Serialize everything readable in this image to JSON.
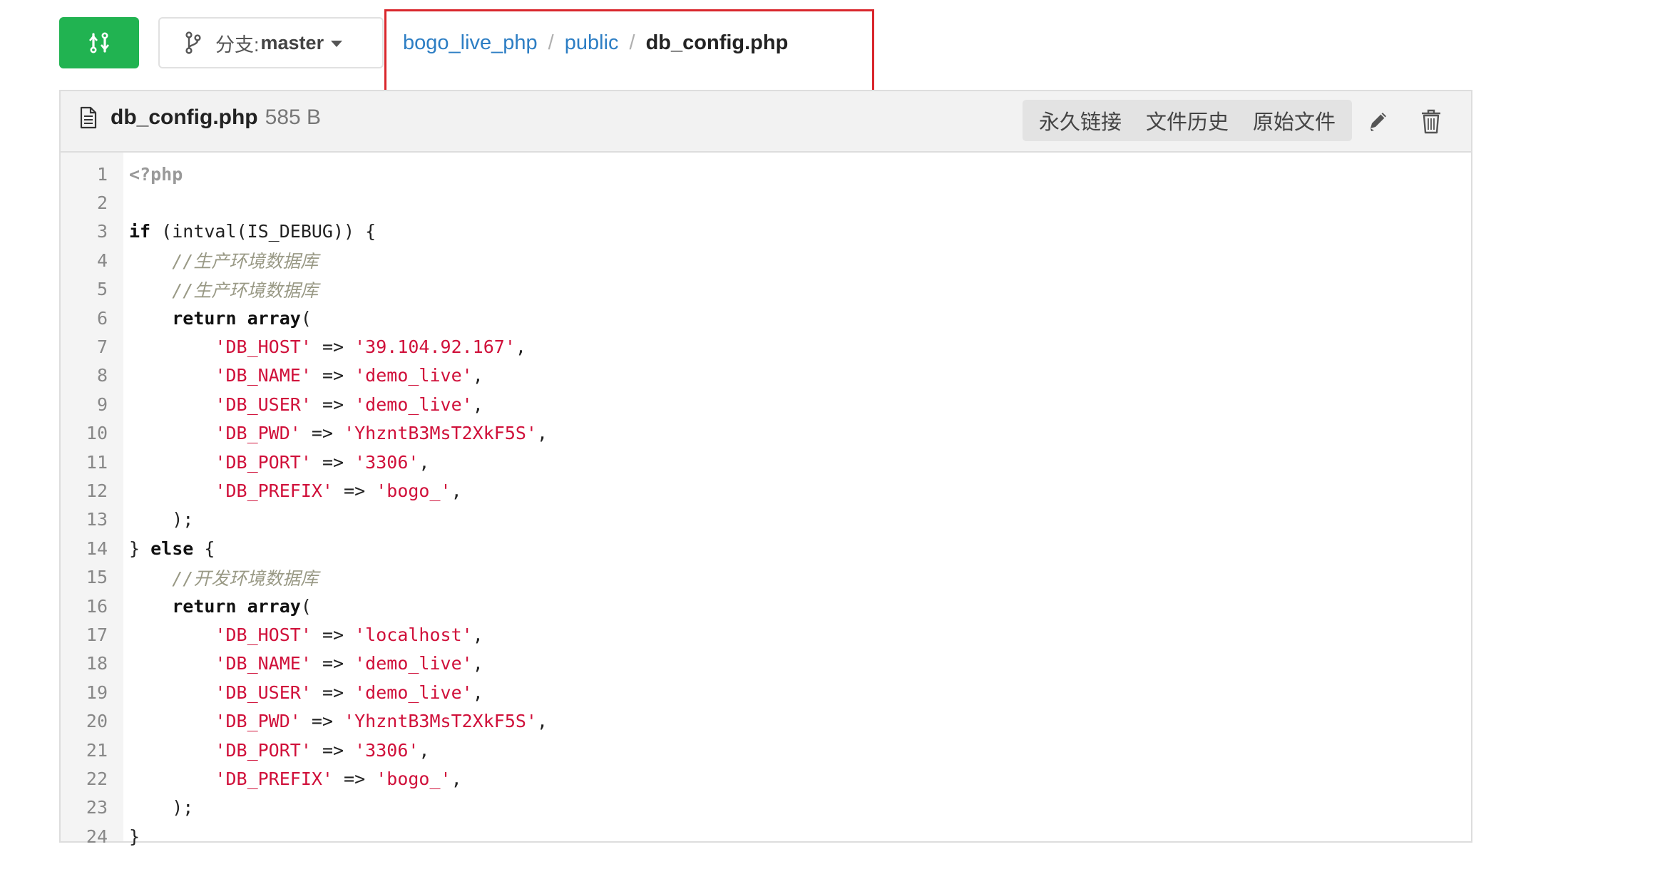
{
  "branch": {
    "prefix": "分支: ",
    "name": "master"
  },
  "breadcrumb": {
    "repo": "bogo_live_php",
    "folder": "public",
    "separator": "/",
    "current": "db_config.php"
  },
  "file": {
    "name": "db_config.php",
    "size": "585 B"
  },
  "actions": {
    "permalink": "永久链接",
    "history": "文件历史",
    "raw": "原始文件"
  },
  "icons": {
    "compare": "compare-icon",
    "branch": "branch-icon",
    "file": "file-icon",
    "edit": "pencil-icon",
    "delete": "trash-icon"
  },
  "colors": {
    "compare_button": "#21b351",
    "highlight_box": "#d9262c",
    "link": "#2d7ec4",
    "string": "#d0103a",
    "comment": "#999985"
  },
  "code": [
    {
      "n": "1",
      "t": [
        {
          "c": "meta",
          "v": "<?php"
        }
      ]
    },
    {
      "n": "2",
      "t": []
    },
    {
      "n": "3",
      "t": [
        {
          "c": "kw",
          "v": "if"
        },
        {
          "c": "plain",
          "v": " (intval(IS_DEBUG)) {"
        }
      ]
    },
    {
      "n": "4",
      "t": [
        {
          "c": "plain",
          "v": "    "
        },
        {
          "c": "cm",
          "v": "//生产环境数据库"
        }
      ]
    },
    {
      "n": "5",
      "t": [
        {
          "c": "plain",
          "v": "    "
        },
        {
          "c": "cm",
          "v": "//生产环境数据库"
        }
      ]
    },
    {
      "n": "6",
      "t": [
        {
          "c": "plain",
          "v": "    "
        },
        {
          "c": "kw",
          "v": "return array"
        },
        {
          "c": "plain",
          "v": "("
        }
      ]
    },
    {
      "n": "7",
      "t": [
        {
          "c": "plain",
          "v": "        "
        },
        {
          "c": "str",
          "v": "'DB_HOST'"
        },
        {
          "c": "plain",
          "v": " => "
        },
        {
          "c": "str",
          "v": "'39.104.92.167'"
        },
        {
          "c": "plain",
          "v": ","
        }
      ]
    },
    {
      "n": "8",
      "t": [
        {
          "c": "plain",
          "v": "        "
        },
        {
          "c": "str",
          "v": "'DB_NAME'"
        },
        {
          "c": "plain",
          "v": " => "
        },
        {
          "c": "str",
          "v": "'demo_live'"
        },
        {
          "c": "plain",
          "v": ","
        }
      ]
    },
    {
      "n": "9",
      "t": [
        {
          "c": "plain",
          "v": "        "
        },
        {
          "c": "str",
          "v": "'DB_USER'"
        },
        {
          "c": "plain",
          "v": " => "
        },
        {
          "c": "str",
          "v": "'demo_live'"
        },
        {
          "c": "plain",
          "v": ","
        }
      ]
    },
    {
      "n": "10",
      "t": [
        {
          "c": "plain",
          "v": "        "
        },
        {
          "c": "str",
          "v": "'DB_PWD'"
        },
        {
          "c": "plain",
          "v": " => "
        },
        {
          "c": "str",
          "v": "'YhzntB3MsT2XkF5S'"
        },
        {
          "c": "plain",
          "v": ","
        }
      ]
    },
    {
      "n": "11",
      "t": [
        {
          "c": "plain",
          "v": "        "
        },
        {
          "c": "str",
          "v": "'DB_PORT'"
        },
        {
          "c": "plain",
          "v": " => "
        },
        {
          "c": "str",
          "v": "'3306'"
        },
        {
          "c": "plain",
          "v": ","
        }
      ]
    },
    {
      "n": "12",
      "t": [
        {
          "c": "plain",
          "v": "        "
        },
        {
          "c": "str",
          "v": "'DB_PREFIX'"
        },
        {
          "c": "plain",
          "v": " => "
        },
        {
          "c": "str",
          "v": "'bogo_'"
        },
        {
          "c": "plain",
          "v": ","
        }
      ]
    },
    {
      "n": "13",
      "t": [
        {
          "c": "plain",
          "v": "    );"
        }
      ]
    },
    {
      "n": "14",
      "t": [
        {
          "c": "plain",
          "v": "} "
        },
        {
          "c": "kw",
          "v": "else"
        },
        {
          "c": "plain",
          "v": " {"
        }
      ]
    },
    {
      "n": "15",
      "t": [
        {
          "c": "plain",
          "v": "    "
        },
        {
          "c": "cm",
          "v": "//开发环境数据库"
        }
      ]
    },
    {
      "n": "16",
      "t": [
        {
          "c": "plain",
          "v": "    "
        },
        {
          "c": "kw",
          "v": "return array"
        },
        {
          "c": "plain",
          "v": "("
        }
      ]
    },
    {
      "n": "17",
      "t": [
        {
          "c": "plain",
          "v": "        "
        },
        {
          "c": "str",
          "v": "'DB_HOST'"
        },
        {
          "c": "plain",
          "v": " => "
        },
        {
          "c": "str",
          "v": "'localhost'"
        },
        {
          "c": "plain",
          "v": ","
        }
      ]
    },
    {
      "n": "18",
      "t": [
        {
          "c": "plain",
          "v": "        "
        },
        {
          "c": "str",
          "v": "'DB_NAME'"
        },
        {
          "c": "plain",
          "v": " => "
        },
        {
          "c": "str",
          "v": "'demo_live'"
        },
        {
          "c": "plain",
          "v": ","
        }
      ]
    },
    {
      "n": "19",
      "t": [
        {
          "c": "plain",
          "v": "        "
        },
        {
          "c": "str",
          "v": "'DB_USER'"
        },
        {
          "c": "plain",
          "v": " => "
        },
        {
          "c": "str",
          "v": "'demo_live'"
        },
        {
          "c": "plain",
          "v": ","
        }
      ]
    },
    {
      "n": "20",
      "t": [
        {
          "c": "plain",
          "v": "        "
        },
        {
          "c": "str",
          "v": "'DB_PWD'"
        },
        {
          "c": "plain",
          "v": " => "
        },
        {
          "c": "str",
          "v": "'YhzntB3MsT2XkF5S'"
        },
        {
          "c": "plain",
          "v": ","
        }
      ]
    },
    {
      "n": "21",
      "t": [
        {
          "c": "plain",
          "v": "        "
        },
        {
          "c": "str",
          "v": "'DB_PORT'"
        },
        {
          "c": "plain",
          "v": " => "
        },
        {
          "c": "str",
          "v": "'3306'"
        },
        {
          "c": "plain",
          "v": ","
        }
      ]
    },
    {
      "n": "22",
      "t": [
        {
          "c": "plain",
          "v": "        "
        },
        {
          "c": "str",
          "v": "'DB_PREFIX'"
        },
        {
          "c": "plain",
          "v": " => "
        },
        {
          "c": "str",
          "v": "'bogo_'"
        },
        {
          "c": "plain",
          "v": ","
        }
      ]
    },
    {
      "n": "23",
      "t": [
        {
          "c": "plain",
          "v": "    );"
        }
      ]
    },
    {
      "n": "24",
      "t": [
        {
          "c": "plain",
          "v": "}"
        }
      ]
    }
  ]
}
